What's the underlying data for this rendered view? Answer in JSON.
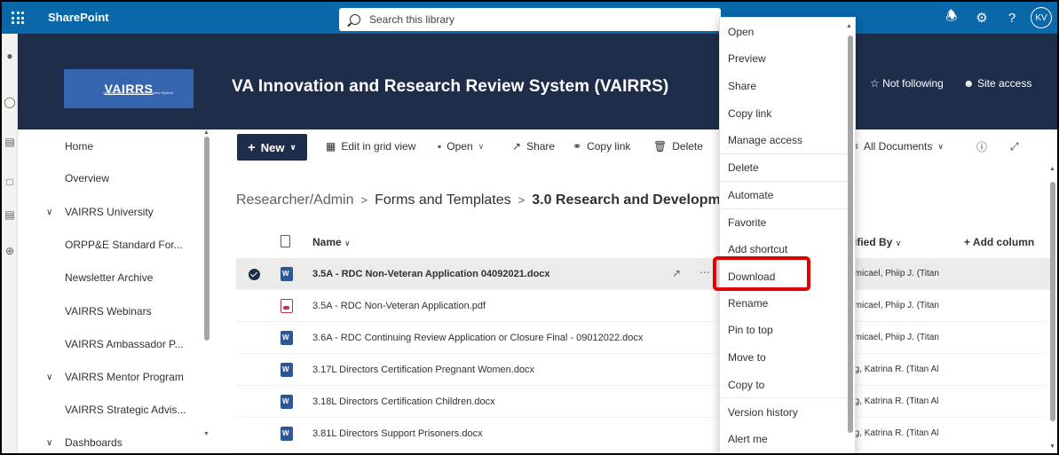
{
  "suitebar": {
    "app_name": "SharePoint",
    "search_placeholder": "Search this library",
    "avatar_initials": "KV",
    "help_glyph": "?"
  },
  "site": {
    "logo_text": "VAIRRS",
    "logo_subtext": "VA Innovation and Research Review System",
    "title": "VA Innovation and Research Review System (VAIRRS)",
    "follow_label": "Not following",
    "site_access_label": "Site access"
  },
  "leftnav": {
    "items": [
      {
        "label": "Home",
        "expandable": false
      },
      {
        "label": "Overview",
        "expandable": false
      },
      {
        "label": "VAIRRS University",
        "expandable": true
      },
      {
        "label": "ORPP&E Standard For...",
        "expandable": false
      },
      {
        "label": "Newsletter Archive",
        "expandable": false
      },
      {
        "label": "VAIRRS Webinars",
        "expandable": false
      },
      {
        "label": "VAIRRS Ambassador P...",
        "expandable": false
      },
      {
        "label": "VAIRRS Mentor Program",
        "expandable": true
      },
      {
        "label": "VAIRRS Strategic Advis...",
        "expandable": false
      },
      {
        "label": "Dashboards",
        "expandable": true
      }
    ]
  },
  "commandbar": {
    "new_label": "New",
    "edit_grid_label": "Edit in grid view",
    "open_label": "Open",
    "share_label": "Share",
    "copy_link_label": "Copy link",
    "delete_label": "Delete",
    "view_label": "All Documents"
  },
  "breadcrumb": {
    "items": [
      "Researcher/Admin",
      "Forms and Templates",
      "3.0 Research and Development C"
    ]
  },
  "list": {
    "columns": {
      "name": "Name",
      "modified_by": "lodified By",
      "add_column": "+ Add column"
    },
    "rows": [
      {
        "name": "3.5A - RDC Non-Veteran Application 04092021.docx",
        "type": "word",
        "modified_by": "ndemicael, Phiip J. (Titan",
        "selected": true
      },
      {
        "name": "3.5A - RDC Non-Veteran Application.pdf",
        "type": "pdf",
        "modified_by": "ndemicael, Phiip J. (Titan",
        "selected": false
      },
      {
        "name": "3.6A - RDC Continuing Review Application or Closure Final - 09012022.docx",
        "type": "word",
        "modified_by": "ndemicael, Phiip J. (Titan",
        "selected": false
      },
      {
        "name": "3.17L Directors Certification Pregnant Women.docx",
        "type": "word",
        "modified_by": "oung, Katrina R. (Titan Al",
        "selected": false
      },
      {
        "name": "3.18L Directors Certification Children.docx",
        "type": "word",
        "modified_by": "oung, Katrina R. (Titan Al",
        "selected": false
      },
      {
        "name": "3.81L Directors Support Prisoners.docx",
        "type": "word",
        "modified_by": "oung, Katrina R. (Titan Al",
        "selected": false
      }
    ]
  },
  "context_menu": {
    "items": [
      "Open",
      "Preview",
      "Share",
      "Copy link",
      "Manage access",
      "Delete",
      "Automate",
      "Favorite",
      "Add shortcut",
      "Download",
      "Rename",
      "Pin to top",
      "Move to",
      "Copy to",
      "Version history",
      "Alert me"
    ],
    "highlighted": "Download"
  },
  "colors": {
    "suitebar": "#0a67a8",
    "header": "#1e2d4a",
    "highlight": "#e00000"
  }
}
